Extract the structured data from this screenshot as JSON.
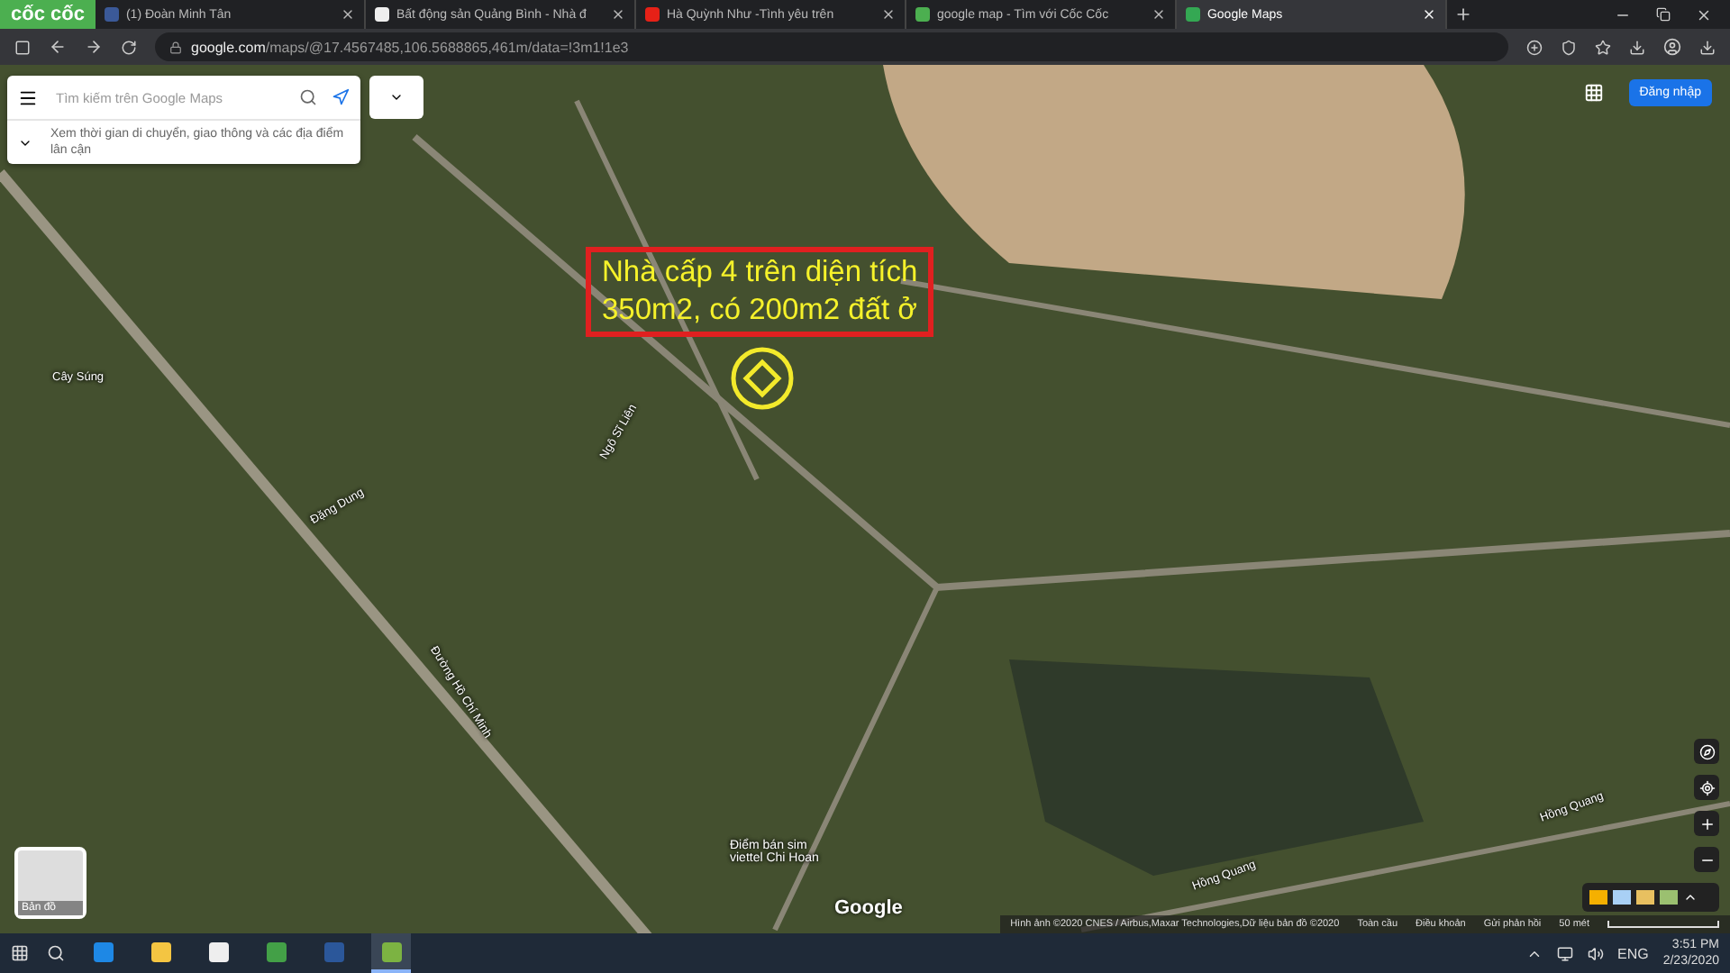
{
  "browser": {
    "brand": "cốc cốc",
    "tabs": [
      {
        "title": "(1) Đoàn Minh Tân",
        "kind": "facebook",
        "selected": false
      },
      {
        "title": "Bất động sản Quảng Bình - Nhà đ",
        "kind": "page",
        "selected": false
      },
      {
        "title": "Hà Quỳnh Như -Tình yêu trên",
        "kind": "video",
        "selected": false
      },
      {
        "title": "google map - Tìm với Cốc Cốc",
        "kind": "search",
        "selected": false
      },
      {
        "title": "Google Maps",
        "kind": "maps",
        "selected": true
      }
    ],
    "address": {
      "domain": "google.com",
      "path": "/maps/@17.4567485,106.5688865,461m/data=!3m1!1e3"
    }
  },
  "maps": {
    "search_placeholder": "Tìm kiếm trên Google Maps",
    "hint": "Xem thời gian di chuyển, giao thông và các địa điểm lân cận",
    "sign_in": "Đăng nhập",
    "layer_label": "Bản đồ",
    "logo": "Google",
    "annotation": {
      "lines": [
        "Nhà cấp 4 trên diện tích",
        "350m2, có 200m2 đất ở"
      ]
    },
    "labels": [
      {
        "text": "Cây Súng",
        "kind": "place"
      },
      {
        "text": "Điểm bán sim viettel Chi Hoan",
        "kind": "poi"
      },
      {
        "text": "Ngô Sĩ Liên",
        "kind": "street"
      },
      {
        "text": "Đường Hồ Chí Minh",
        "kind": "street"
      },
      {
        "text": "Đặng Dung",
        "kind": "street"
      },
      {
        "text": "Hồng Quang",
        "kind": "street"
      },
      {
        "text": "Hồng Quang",
        "kind": "street"
      }
    ],
    "footer": [
      {
        "text": "Hình ảnh ©2020 CNES / Airbus,Maxar Technologies,Dữ liệu bản đồ ©2020"
      },
      {
        "text": "Toàn cầu"
      },
      {
        "text": "Điều khoản"
      },
      {
        "text": "Gửi phản hồi"
      }
    ],
    "scale": "50 mét"
  },
  "taskbar": {
    "apps": [
      {
        "kind": "edge",
        "active": false
      },
      {
        "kind": "folder",
        "active": false
      },
      {
        "kind": "mail",
        "active": false
      },
      {
        "kind": "sheet",
        "active": false
      },
      {
        "kind": "word",
        "active": false
      },
      {
        "kind": "coccoc",
        "active": true
      }
    ],
    "language": "ENG",
    "time": "3:51 PM",
    "date": "2/23/2020"
  }
}
